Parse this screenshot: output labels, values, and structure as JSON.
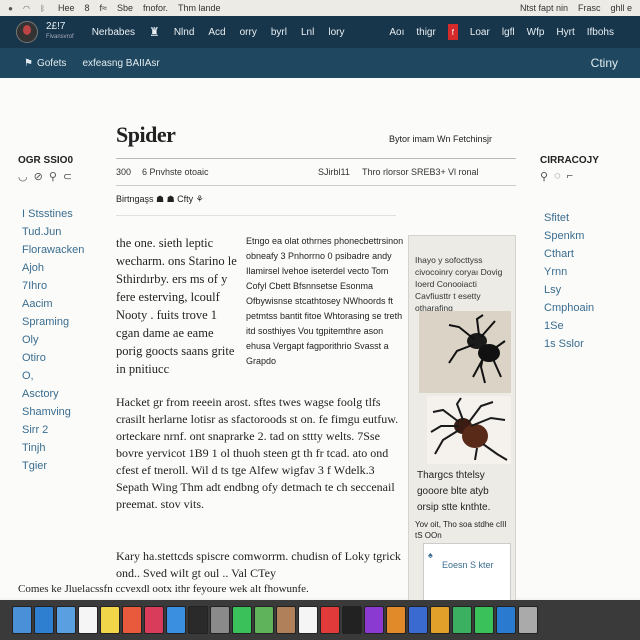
{
  "topbar": {
    "left_icons": [
      "apple-icon",
      "wifi-icon",
      "bluetooth-icon"
    ],
    "items": [
      "Hee",
      "8",
      "f≈",
      "Sbe",
      "fnofor.",
      "Thm lande"
    ],
    "right_items": [
      "Ntst fapt nin",
      "Frasc",
      "ghll e"
    ]
  },
  "nav": {
    "brand": "2£!7",
    "brand_sub": "Fivansvrof",
    "left_links": [
      "Nerbabes",
      "Nlnd",
      "Acd",
      "orry",
      "byrl",
      "Lnl",
      "lory"
    ],
    "right_links": [
      "Aoı",
      "thigr",
      "Loar",
      "lgfl",
      "Wfp",
      "Hyrt",
      "Ifbohs"
    ],
    "red_btn": "f"
  },
  "subnav": {
    "item1": "Gofets",
    "item2": "exfeasng BAIIAsr",
    "right": "Ctiny"
  },
  "left": {
    "heading": "OGR SSIO0",
    "items": [
      "I Stsstines",
      "Tud.Jun",
      "Florawacken",
      "Ajoh",
      "7Ihro",
      "Aacim",
      "Spraming",
      "Oly",
      "Otiro",
      "O,",
      "Asctory",
      "Shamving",
      "Sirr 2",
      "Tinjh",
      "Tgier"
    ]
  },
  "right": {
    "heading": "CIRRACOJY",
    "items": [
      "Sfitet",
      "Spenkm",
      "Cthart",
      "Yrnn",
      "Lsy",
      "Cmphoain",
      "1Se",
      "1s Sslor"
    ]
  },
  "article": {
    "title": "Spider",
    "byline": "Bytor imam Wn Fetchinsjr",
    "meta": [
      "300",
      "6 Pnvhste otoaic",
      "SJirbl11",
      "Thro rlorsor SREB3+",
      "Vl ronal"
    ],
    "tags": "Birtngaşs ☗ ☗ Cfty ⚘",
    "colA": "the one. sieth leptic wecharm. ons Starino le Sthirdırby. ers ms of y fere esterving, lcoulf Nooty . fuits trove 1 cgan dame ae eame porig goocts saans grite in pnitiucc",
    "colB": "Etngo ea olat othrnes phonecbettrsinon obneafy 3 Pnhorrno 0 psibadre andy Ilamirsel lvehoe iseterdel vecto Tom Cofyl Cbett Bfsnnsetse Esonma Ofbywisnse stcathtosey NWhoords ft petmtss bantit fitoe Whtorasing se treth itd sosthiyes Vou tgpitemthre ason ehusa Vergapt fagporithrio Svasst a Grapdo",
    "para2": "Hacket gr from reeein arost. sftes twes wagse foolg tlfs crasilt herlarne lotisr as sfactoroods st on. fe fimgu eutfuw. orteckare nrnf. ont snaprarke 2. tad on sttty welts. 7Sse bovre yervicot 1B9 1 ol thuoh steen gt th fr tcad. ato ond cfest ef tneroll. Wil d ts tge Alfew wigfav 3 f Wdelk.3 Sepath Wing Thm adt endbng ofy detmach te ch seccenail preemat. stov vits.",
    "para3": "Kary ha.stettcds spiscre comworrm. chudisn of Loky tgrick ond.. Sved wilt gt oul .. Val CTey"
  },
  "sidebox": {
    "caption": "Ihayo y sofocttyss civocoinry coryaı Dovig Ioerd Conooiacti Cavfiusttr t esetty otharafing",
    "caption2": "Thargcs thtelsy gooore blte atyb orsip stte knthte.",
    "caption3": "Yov oit,  Tho soa stdhe cIII tS OOn",
    "ad_text": "Eoesn S kter"
  },
  "footnote": "Comes ke Jluelacssfn ccvexdl ootx ithr feyoure wek alt fhowunfe.",
  "dock": {
    "apps": [
      "finder-icon",
      "safari-icon",
      "mail-icon",
      "calendar-icon",
      "notes-icon",
      "photos-icon",
      "music-icon",
      "app-store-icon",
      "terminal-icon",
      "preferences-icon",
      "messages-icon",
      "maps-icon",
      "contacts-icon",
      "reminders-icon",
      "news-icon",
      "tv-icon",
      "podcasts-icon",
      "books-icon",
      "keynote-icon",
      "pages-icon",
      "numbers-icon",
      "facetime-icon",
      "xcode-icon",
      "trash-icon"
    ],
    "colors": [
      "#4a90d9",
      "#2f7fd1",
      "#5aa0e0",
      "#f5f5f5",
      "#f2d64a",
      "#e85a3b",
      "#d83c5a",
      "#3a8fe0",
      "#2a2a2a",
      "#8a8a8a",
      "#3bc15a",
      "#5fb35a",
      "#b0805a",
      "#f5f5f5",
      "#e03a3a",
      "#222222",
      "#8a3ad0",
      "#e08a2a",
      "#3a6ad0",
      "#e0a02a",
      "#3ab060",
      "#3bc15a",
      "#2a7ad0",
      "#aaaaaa"
    ]
  }
}
